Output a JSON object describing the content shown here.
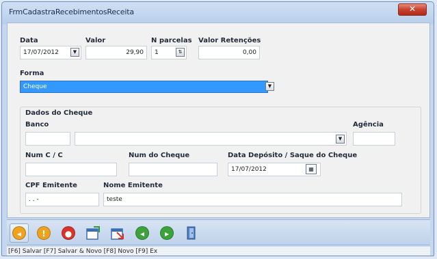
{
  "window": {
    "title": "FrmCadastraRecebimentosReceita",
    "close_label": "✕"
  },
  "form": {
    "data_label": "Data",
    "data_value": "17/07/2012",
    "valor_label": "Valor",
    "valor_value": "29,90",
    "parcelas_label": "N parcelas",
    "parcelas_value": "1",
    "retencoes_label": "Valor Retenções",
    "retencoes_value": "0,00",
    "forma_label": "Forma",
    "forma_value": "Cheque"
  },
  "cheque": {
    "group_label": "Dados do Cheque",
    "banco_label": "Banco",
    "banco_code": "",
    "banco_name": "",
    "agencia_label": "Agência",
    "agencia_value": "",
    "numcc_label": "Num C / C",
    "numcc_value": "",
    "numcheque_label": "Num do Cheque",
    "numcheque_value": "",
    "deposito_label": "Data Depósito / Saque do Cheque",
    "deposito_value": "17/07/2012",
    "cpf_label": "CPF Emitente",
    "cpf_value": " .  .  -",
    "nome_label": "Nome Emitente",
    "nome_value": "teste"
  },
  "status": {
    "text": "[F6] Salvar [F7] Salvar & Novo [F8] Novo [F9] Ex"
  },
  "colors": {
    "selection": "#3399ff",
    "close": "#c7412e",
    "green": "#3ca33c",
    "orange": "#f0a21e",
    "red": "#d9342b"
  }
}
